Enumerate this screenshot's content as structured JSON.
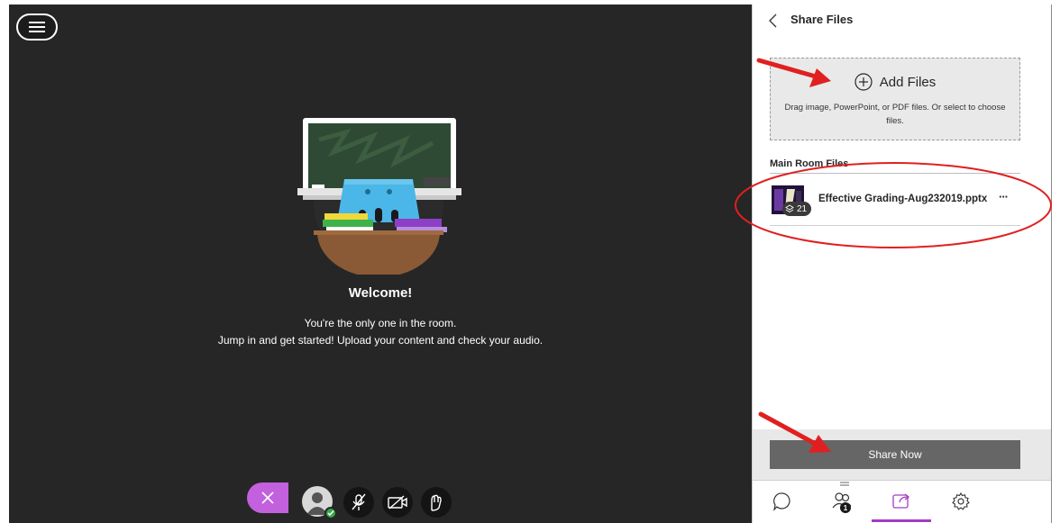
{
  "stage": {
    "welcome_title": "Welcome!",
    "welcome_line1": "You're the only one in the room.",
    "welcome_line2": "Jump in and get started! Upload your content and check your audio.",
    "controls": [
      "avatar",
      "mic-muted-icon",
      "camera-off-icon",
      "hand-raise-icon"
    ]
  },
  "panel": {
    "title": "Share Files",
    "add_files_label": "Add Files",
    "drop_hint": "Drag image, PowerPoint, or PDF files. Or select to choose files.",
    "section_label": "Main Room Files",
    "files": [
      {
        "name": "Effective Grading-Aug232019.pptx",
        "slide_count": "21",
        "more": "···"
      }
    ],
    "share_button": "Share Now",
    "participants_count": "1"
  },
  "colors": {
    "stage_bg": "#262626",
    "accent": "#a43cc0",
    "close_tab": "#c260de",
    "share_button": "#666666",
    "annotation": "#e02020"
  }
}
